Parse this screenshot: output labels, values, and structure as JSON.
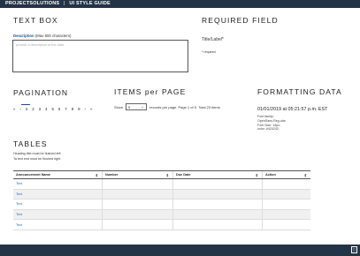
{
  "header": {
    "brand": "PROJECTSOLUTIONS",
    "separator": "|",
    "section": "UI STYLE GUIDE"
  },
  "textbox": {
    "title": "TEXT BOX",
    "label": "Description",
    "hint": "(Max 500 characters)",
    "placeholder": "provide a description of the data"
  },
  "required": {
    "title": "REQUIRED FIELD",
    "label": "Title/Label*",
    "note": "* required"
  },
  "pagination": {
    "title": "PAGINATION",
    "pages": [
      "«",
      "‹",
      "1",
      "2",
      "3",
      "4",
      "5",
      "6",
      "7",
      "8",
      "9",
      "›",
      "»"
    ],
    "current": "1"
  },
  "items_per_page": {
    "title": "ITEMS per PAGE",
    "show_label": "Show",
    "selected": "5",
    "summary": "records per page. Page 1 of 5. Total 23 items"
  },
  "formatting": {
    "title": "FORMATTING DATA",
    "datetime": "01/01/2019 at 05:21:57 p.m. EST",
    "font_lines": [
      "Font family:",
      "OpenSans-Reg.ular",
      "Font Size: 14px;",
      "color: #424242;"
    ]
  },
  "tables": {
    "title": "TABLES",
    "note1": "Heading title must be flushed left",
    "note2": "Ta text end must be flushed right",
    "columns": [
      "Announcement Name",
      "Number",
      "Due Date",
      "Action"
    ],
    "rows": [
      [
        "Text",
        "",
        "",
        ""
      ],
      [
        "Text",
        "",
        "",
        ""
      ],
      [
        "Text",
        "",
        "",
        ""
      ],
      [
        "Text",
        "",
        "",
        ""
      ],
      [
        "Text",
        "",
        "",
        ""
      ]
    ]
  },
  "colors": {
    "bar": "#243447",
    "accent": "#1f4e8c",
    "link": "#1f6bb5"
  },
  "footer": {
    "button_icon": "scroll-top-icon",
    "button_glyph": "▯"
  }
}
